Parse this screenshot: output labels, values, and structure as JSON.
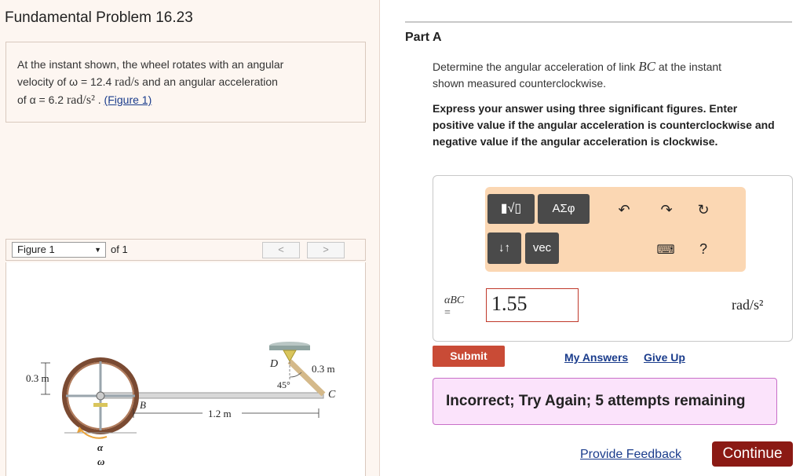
{
  "problem": {
    "title": "Fundamental Problem 16.23",
    "line1": "At the instant shown, the wheel rotates with an angular",
    "line2_pre": "velocity of ω = 12.4",
    "line2_unit": "rad/s",
    "line2_post": "and an angular acceleration",
    "line3_pre": "of α = 6.2",
    "line3_unit": "rad/s²",
    "line3_sep": ".",
    "figure_link": "(Figure 1)"
  },
  "figure_nav": {
    "selected": "Figure 1",
    "of_text": "of 1",
    "prev": "<",
    "next": ">"
  },
  "figure": {
    "wheel_radius_label": "0.3 m",
    "rod_length_label": "1.2 m",
    "link_length_label": "0.3 m",
    "angle_label": "45°",
    "point_b": "B",
    "point_c": "C",
    "point_d": "D",
    "alpha_label": "α",
    "omega_label": "ω"
  },
  "part": {
    "title": "Part A",
    "question_pre": "Determine the angular acceleration of link",
    "question_var": "BC",
    "question_post": "at the instant",
    "question_line2": "shown measured counterclockwise.",
    "instructions": "Express your answer using three significant figures. Enter positive value if the angular acceleration is counterclockwise and negative value if the angular acceleration is clockwise."
  },
  "toolbar": {
    "templates_icon": "templates-icon",
    "greek_label": "ΑΣφ",
    "undo_icon": "undo-icon",
    "redo_icon": "redo-icon",
    "reset_icon": "reset-icon",
    "sort_label": "↓↑",
    "vec_label": "vec",
    "keyboard_icon": "keyboard-icon",
    "help_label": "?"
  },
  "answer": {
    "label": "αBC",
    "eq": "=",
    "value": "1.55",
    "unit": "rad/s²"
  },
  "actions": {
    "submit": "Submit",
    "my_answers": "My Answers",
    "give_up": "Give Up",
    "feedback": "Incorrect; Try Again; 5 attempts remaining",
    "provide_feedback": "Provide Feedback",
    "continue": "Continue"
  },
  "colors": {
    "submit_bg": "#c94b36",
    "continue_bg": "#8b1a14",
    "toolbar_bg": "#fbd7b3",
    "feedback_bg": "#fbe3fb",
    "link": "#1a3c8c"
  }
}
